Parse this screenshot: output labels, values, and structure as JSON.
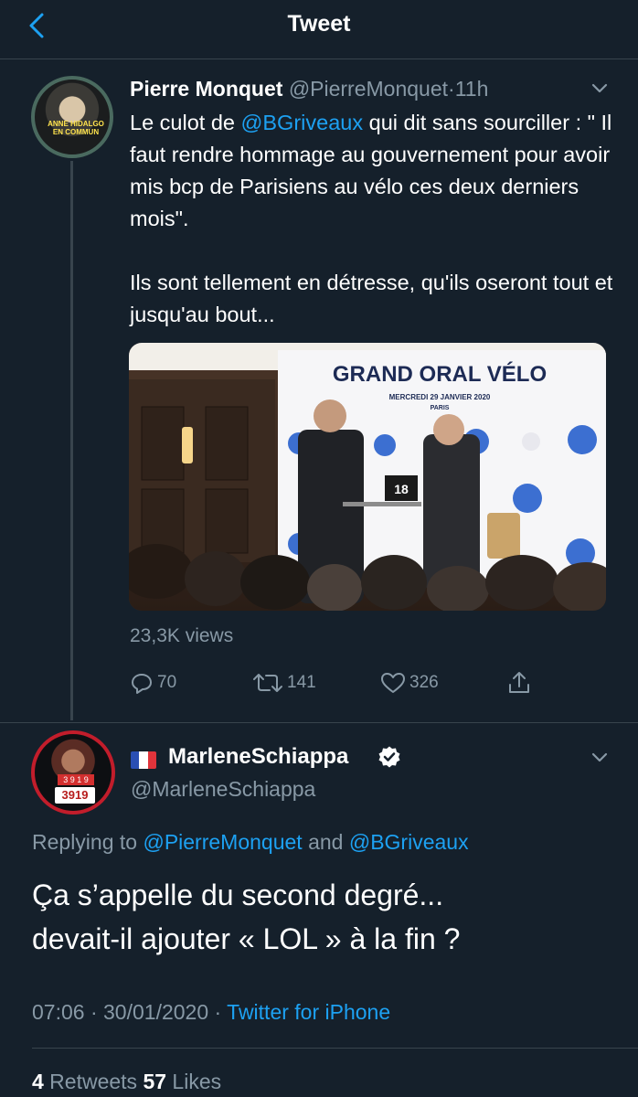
{
  "header": {
    "title": "Tweet"
  },
  "tweet1": {
    "avatar_text": "ANNE HIDALGO EN COMMUN",
    "name": "Pierre Monquet",
    "handle": "@PierreMonquet",
    "dot": "·",
    "time": "11h",
    "body_pre": "Le culot de ",
    "body_mention": "@BGriveaux",
    "body_post": " qui dit sans sourciller : \" Il faut rendre hommage au gouvernement pour avoir mis bcp de Parisiens au vélo ces deux derniers mois\".",
    "body_p2": "Ils sont tellement en détresse, qu'ils oseront tout et jusqu'au bout...",
    "media": {
      "banner_title": "GRAND ORAL VÉLO",
      "banner_date": "MERCREDI 29 JANVIER 2020",
      "banner_city": "PARIS",
      "laptop_text": "18"
    },
    "views": "23,3K views",
    "replies": "70",
    "retweets": "141",
    "likes": "326"
  },
  "tweet2": {
    "avatar_sign": "3919",
    "avatar_top": "3 9 1 9",
    "name": "MarleneSchiappa",
    "handle": "@MarleneSchiappa",
    "replying_prefix": "Replying to ",
    "replying_user1": "@PierreMonquet",
    "replying_and": " and ",
    "replying_user2": "@BGriveaux",
    "body_line1": "Ça s’appelle du second degré...",
    "body_line2": "devait-il ajouter « LOL » à la fin ?",
    "time": "07:06",
    "sep": " · ",
    "date": "30/01/2020",
    "sep2": " · ",
    "client": "Twitter for iPhone",
    "retweets_count": "4",
    "retweets_label": " Retweets ",
    "likes_count": "57",
    "likes_label": " Likes"
  },
  "colors": {
    "background": "#15202b",
    "accent": "#1da1f2",
    "muted": "#8899a6",
    "divider": "#38444d"
  }
}
